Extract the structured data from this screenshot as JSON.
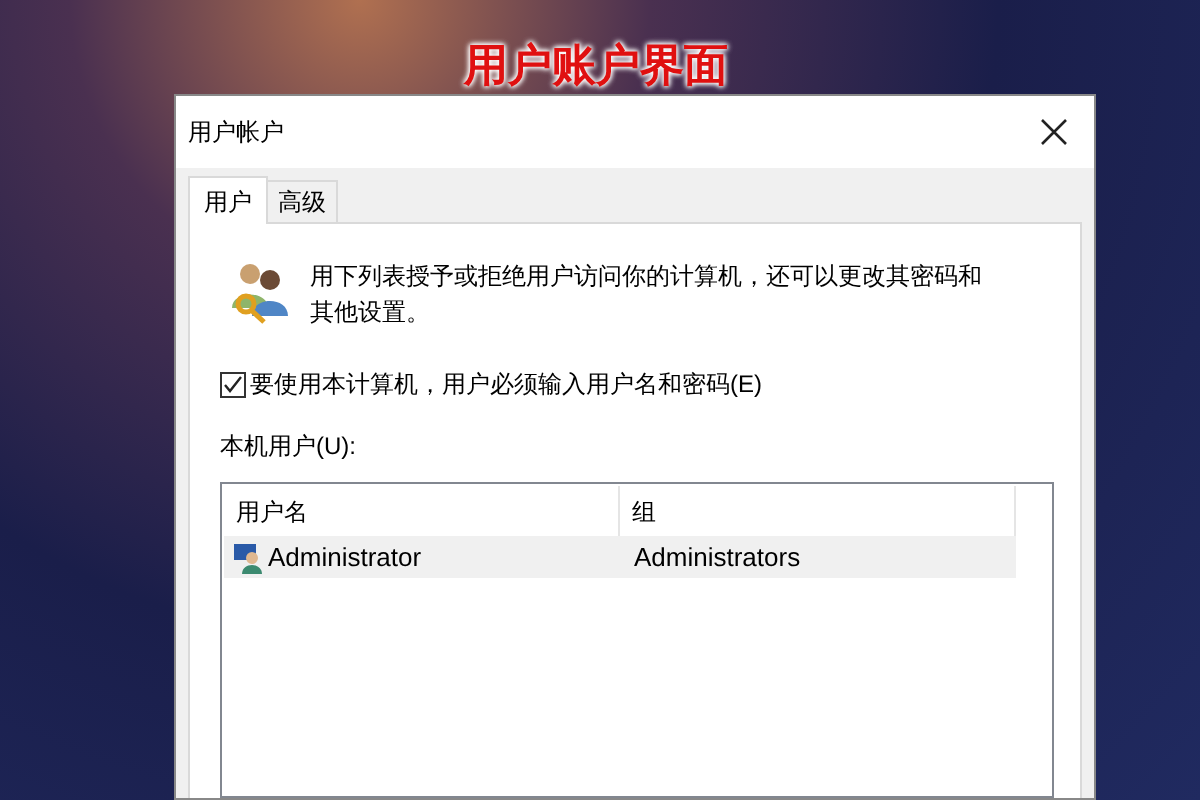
{
  "caption": "用户账户界面",
  "window": {
    "title": "用户帐户"
  },
  "tabs": [
    {
      "label": "用户",
      "selected": true
    },
    {
      "label": "高级",
      "selected": false
    }
  ],
  "intro": "用下列表授予或拒绝用户访问你的计算机，还可以更改其密码和其他设置。",
  "require_login": {
    "label": "要使用本计算机，用户必须输入用户名和密码(E)",
    "checked": true
  },
  "users_label": "本机用户(U):",
  "table": {
    "columns": [
      "用户名",
      "组"
    ],
    "rows": [
      {
        "cells": [
          "Administrator",
          "Administrators"
        ],
        "selected": true
      }
    ]
  }
}
